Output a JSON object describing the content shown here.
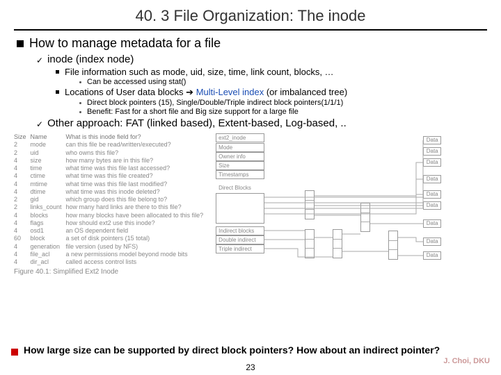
{
  "title": "40. 3 File Organization: The inode",
  "main": {
    "heading": "How to manage metadata for a file",
    "sub1": "inode (index node)",
    "fileinfo": "File information such as mode, uid, size, time, link count, blocks, …",
    "fileinfo_sub": "Can be accessed using stat()",
    "locations_pre": "Locations of User data blocks ",
    "locations_link": "Multi-Level index",
    "locations_post": " (or imbalanced tree)",
    "arrow": "➔",
    "loc_sub1": "Direct block pointers (15), Single/Double/Triple indirect block pointers(1/1/1)",
    "loc_sub2": "Benefit: Fast for a short file and Big size support for a large file",
    "other": "Other approach: FAT (linked based), Extent-based, Log-based, .."
  },
  "table": {
    "h1": "Size",
    "h2": "Name",
    "h3": "What is this inode field for?",
    "rows": [
      {
        "s": "2",
        "n": "mode",
        "d": "can this file be read/written/executed?"
      },
      {
        "s": "2",
        "n": "uid",
        "d": "who owns this file?"
      },
      {
        "s": "4",
        "n": "size",
        "d": "how many bytes are in this file?"
      },
      {
        "s": "4",
        "n": "time",
        "d": "what time was this file last accessed?"
      },
      {
        "s": "4",
        "n": "ctime",
        "d": "what time was this file created?"
      },
      {
        "s": "4",
        "n": "mtime",
        "d": "what time was this file last modified?"
      },
      {
        "s": "4",
        "n": "dtime",
        "d": "what time was this inode deleted?"
      },
      {
        "s": "2",
        "n": "gid",
        "d": "which group does this file belong to?"
      },
      {
        "s": "2",
        "n": "links_count",
        "d": "how many hard links are there to this file?"
      },
      {
        "s": "4",
        "n": "blocks",
        "d": "how many blocks have been allocated to this file?"
      },
      {
        "s": "4",
        "n": "flags",
        "d": "how should ext2 use this inode?"
      },
      {
        "s": "4",
        "n": "osd1",
        "d": "an OS dependent field"
      },
      {
        "s": "60",
        "n": "block",
        "d": "a set of disk pointers (15 total)"
      },
      {
        "s": "4",
        "n": "generation",
        "d": "file version (used by NFS)"
      },
      {
        "s": "4",
        "n": "file_acl",
        "d": "a new permissions model beyond mode bits"
      },
      {
        "s": "4",
        "n": "dir_acl",
        "d": "called access control lists"
      }
    ],
    "caption": "Figure 40.1: Simplified Ext2 Inode"
  },
  "diagram": {
    "inode_label": "ext2_inode",
    "fields": [
      "Mode",
      "Owner info",
      "Size",
      "Timestamps"
    ],
    "direct_label": "Direct Blocks",
    "indirect1": "Indirect blocks",
    "indirect2": "Double indirect",
    "indirect3": "Triple indirect",
    "data": "Data"
  },
  "question": "How large size can be supported by direct block pointers? How about an indirect pointer?",
  "footer": {
    "author": "J. Choi, DKU",
    "page": "23"
  }
}
